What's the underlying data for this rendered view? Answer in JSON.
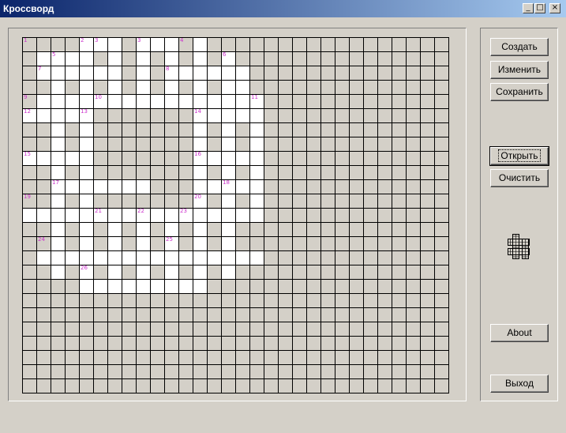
{
  "window": {
    "title": "Кроссворд",
    "min_glyph": "_",
    "max_glyph": "□",
    "close_glyph": "×"
  },
  "buttons": {
    "create": "Создать",
    "edit": "Изменить",
    "save": "Сохранить",
    "open": "Открыть",
    "clear": "Очистить",
    "about": "About",
    "exit": "Выход"
  },
  "grid": {
    "cols": 30,
    "rows": 25,
    "white_rows": [
      [
        4,
        5,
        6,
        8,
        9,
        10,
        12
      ],
      [
        1,
        2,
        3,
        4,
        6,
        8,
        10,
        12,
        14
      ],
      [
        1,
        2,
        3,
        4,
        5,
        6,
        8,
        10,
        11,
        12,
        13,
        14,
        15
      ],
      [
        2,
        4,
        6,
        8,
        10,
        12,
        14,
        15
      ],
      [
        1,
        2,
        3,
        4,
        5,
        6,
        7,
        8,
        9,
        10,
        11,
        12,
        13,
        14,
        15,
        16
      ],
      [
        0,
        1,
        2,
        3,
        4,
        12,
        13,
        14,
        15,
        16
      ],
      [
        2,
        4,
        12,
        14,
        16
      ],
      [
        2,
        4,
        12,
        14,
        16
      ],
      [
        0,
        1,
        2,
        3,
        4,
        12,
        13,
        14,
        15,
        16
      ],
      [
        2,
        4,
        12,
        14,
        16
      ],
      [
        2,
        3,
        4,
        5,
        6,
        7,
        8,
        12,
        13,
        14,
        15,
        16
      ],
      [
        2,
        4,
        12,
        14,
        16
      ],
      [
        0,
        1,
        2,
        3,
        4,
        5,
        6,
        7,
        8,
        9,
        10,
        11,
        12,
        13,
        14,
        15,
        16
      ],
      [
        2,
        4,
        6,
        8,
        10,
        12,
        14
      ],
      [
        2,
        4,
        6,
        8,
        10,
        12,
        14
      ],
      [
        1,
        2,
        3,
        4,
        5,
        6,
        7,
        8,
        9,
        10,
        11,
        12,
        13,
        14,
        15,
        16
      ],
      [
        2,
        4,
        6,
        8,
        10,
        12,
        14
      ],
      [
        4,
        5,
        6,
        7,
        8,
        9,
        10,
        11,
        12
      ]
    ],
    "numbers": [
      {
        "r": 0,
        "c": 0,
        "n": "1"
      },
      {
        "r": 0,
        "c": 4,
        "n": "2"
      },
      {
        "r": 0,
        "c": 5,
        "n": "3"
      },
      {
        "r": 0,
        "c": 8,
        "n": "3"
      },
      {
        "r": 0,
        "c": 11,
        "n": "4"
      },
      {
        "r": 1,
        "c": 2,
        "n": "5"
      },
      {
        "r": 1,
        "c": 14,
        "n": "6"
      },
      {
        "r": 2,
        "c": 1,
        "n": "7"
      },
      {
        "r": 2,
        "c": 10,
        "n": "8"
      },
      {
        "r": 4,
        "c": 0,
        "n": "9"
      },
      {
        "r": 4,
        "c": 5,
        "n": "10"
      },
      {
        "r": 4,
        "c": 16,
        "n": "11"
      },
      {
        "r": 5,
        "c": 0,
        "n": "12"
      },
      {
        "r": 5,
        "c": 4,
        "n": "13"
      },
      {
        "r": 5,
        "c": 12,
        "n": "14"
      },
      {
        "r": 8,
        "c": 0,
        "n": "15"
      },
      {
        "r": 8,
        "c": 12,
        "n": "16"
      },
      {
        "r": 10,
        "c": 2,
        "n": "17"
      },
      {
        "r": 10,
        "c": 14,
        "n": "18"
      },
      {
        "r": 11,
        "c": 0,
        "n": "19"
      },
      {
        "r": 11,
        "c": 12,
        "n": "20"
      },
      {
        "r": 12,
        "c": 5,
        "n": "21"
      },
      {
        "r": 12,
        "c": 8,
        "n": "22"
      },
      {
        "r": 12,
        "c": 11,
        "n": "23"
      },
      {
        "r": 14,
        "c": 1,
        "n": "24"
      },
      {
        "r": 14,
        "c": 10,
        "n": "25"
      },
      {
        "r": 16,
        "c": 4,
        "n": "26"
      }
    ]
  }
}
